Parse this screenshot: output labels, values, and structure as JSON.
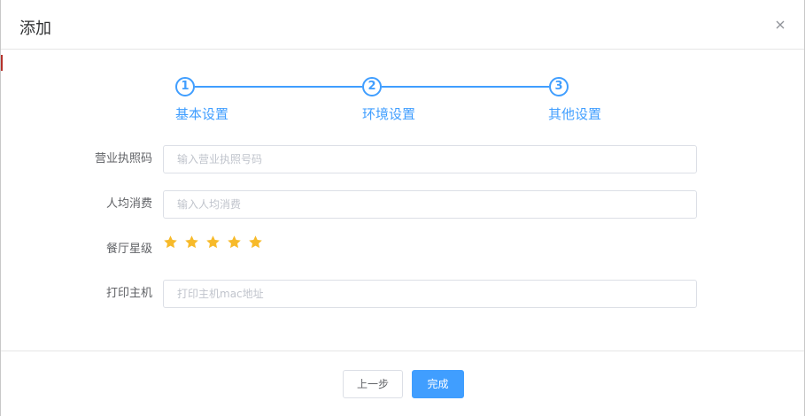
{
  "dialog": {
    "title": "添加"
  },
  "colors": {
    "accent": "#409eff",
    "star": "#f7ba2a"
  },
  "steps": [
    {
      "number": "1",
      "label": "基本设置"
    },
    {
      "number": "2",
      "label": "环境设置"
    },
    {
      "number": "3",
      "label": "其他设置"
    }
  ],
  "form": {
    "license": {
      "label": "营业执照码",
      "placeholder": "输入营业执照号码",
      "value": ""
    },
    "avg_cost": {
      "label": "人均消费",
      "placeholder": "输入人均消费",
      "value": ""
    },
    "rating": {
      "label": "餐厅星级",
      "stars": 5,
      "max": 5,
      "icon": "star-icon"
    },
    "printer": {
      "label": "打印主机",
      "placeholder": "打印主机mac地址",
      "value": ""
    }
  },
  "footer": {
    "prev_label": "上一步",
    "done_label": "完成"
  }
}
